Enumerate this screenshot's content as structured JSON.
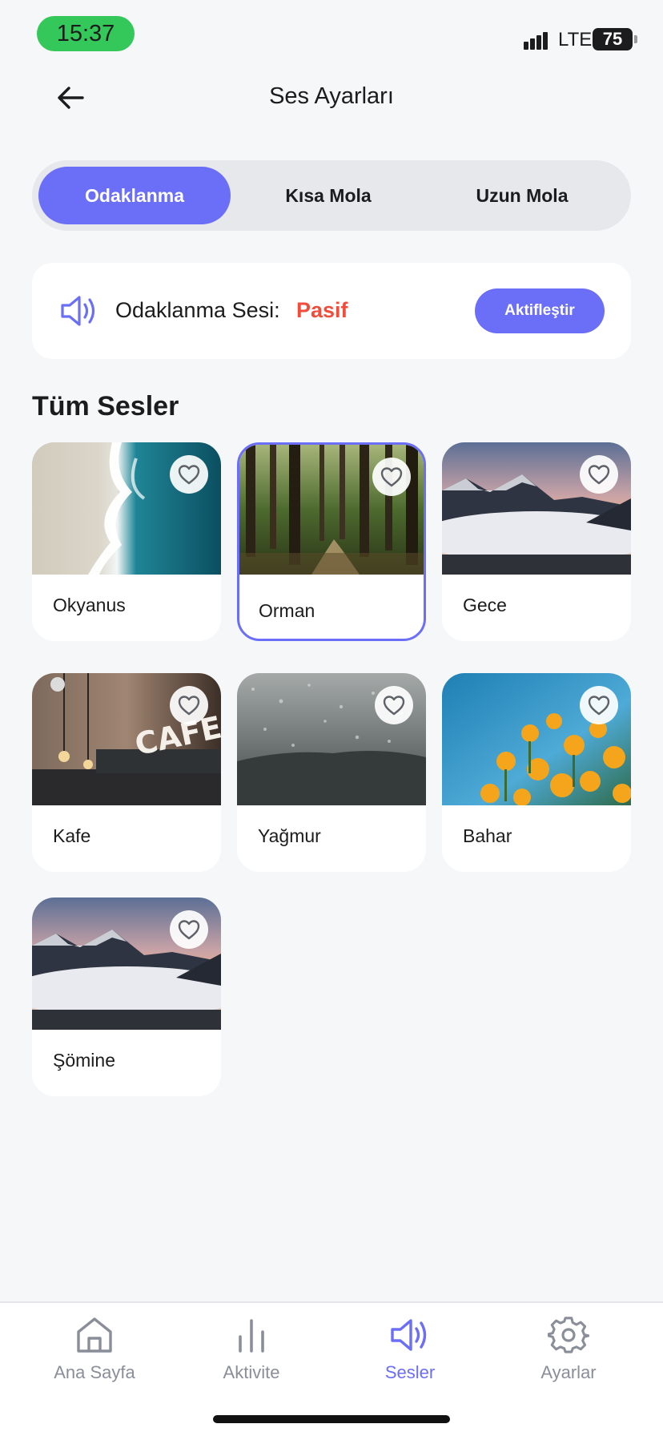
{
  "status_bar": {
    "time": "15:37",
    "network": "LTE",
    "battery": "75"
  },
  "header": {
    "title": "Ses Ayarları",
    "back_icon": "arrow-left-icon"
  },
  "tabs": [
    {
      "label": "Odaklanma",
      "active": true
    },
    {
      "label": "Kısa Mola",
      "active": false
    },
    {
      "label": "Uzun Mola",
      "active": false
    }
  ],
  "sound_status": {
    "label": "Odaklanma Sesi:",
    "state": "Pasif",
    "state_color": "#f04d3c",
    "activate_label": "Aktifleştir",
    "icon": "speaker-icon"
  },
  "section_title": "Tüm Sesler",
  "sounds": [
    {
      "name": "Okyanus",
      "image": "ocean",
      "favorite": false,
      "selected": false
    },
    {
      "name": "Orman",
      "image": "forest",
      "favorite": false,
      "selected": true
    },
    {
      "name": "Gece",
      "image": "mountains",
      "favorite": false,
      "selected": false
    },
    {
      "name": "Kafe",
      "image": "cafe",
      "favorite": false,
      "selected": false
    },
    {
      "name": "Yağmur",
      "image": "rain",
      "favorite": false,
      "selected": false
    },
    {
      "name": "Bahar",
      "image": "flowers",
      "favorite": false,
      "selected": false
    },
    {
      "name": "Şömine",
      "image": "mountains",
      "favorite": false,
      "selected": false
    }
  ],
  "bottom_nav": [
    {
      "label": "Ana Sayfa",
      "icon": "home-icon",
      "active": false
    },
    {
      "label": "Aktivite",
      "icon": "bar-chart-icon",
      "active": false
    },
    {
      "label": "Sesler",
      "icon": "speaker-icon",
      "active": true
    },
    {
      "label": "Ayarlar",
      "icon": "gear-icon",
      "active": false
    }
  ],
  "colors": {
    "accent": "#6b6ef7",
    "inactive": "#8a8e99",
    "background": "#f6f7f9"
  }
}
